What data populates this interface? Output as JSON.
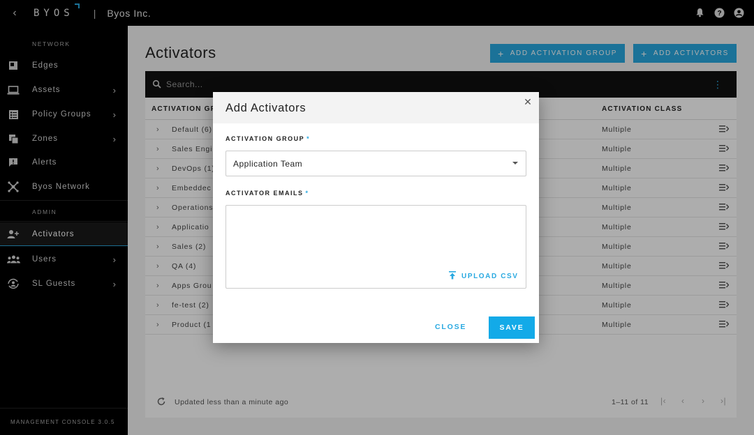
{
  "topbar": {
    "logo": "BYOS",
    "org_name": "Byos Inc."
  },
  "sidebar": {
    "network_label": "NETWORK",
    "admin_label": "ADMIN",
    "items": [
      {
        "label": "Edges"
      },
      {
        "label": "Assets"
      },
      {
        "label": "Policy Groups"
      },
      {
        "label": "Zones"
      },
      {
        "label": "Alerts"
      },
      {
        "label": "Byos Network"
      },
      {
        "label": "Activators"
      },
      {
        "label": "Users"
      },
      {
        "label": "SL Guests"
      }
    ],
    "version": "MANAGEMENT CONSOLE 3.0.5"
  },
  "main": {
    "title": "Activators",
    "add_group_label": "ADD ACTIVATION GROUP",
    "add_activators_label": "ADD ACTIVATORS",
    "search_placeholder": "Search...",
    "columns": {
      "group": "ACTIVATION GR",
      "class": "ACTIVATION CLASS"
    },
    "rows": [
      {
        "name": "Default (6)",
        "class": "Multiple"
      },
      {
        "name": "Sales Engi",
        "class": "Multiple"
      },
      {
        "name": "DevOps (1)",
        "class": "Multiple"
      },
      {
        "name": "Embeddec",
        "class": "Multiple"
      },
      {
        "name": "Operations",
        "class": "Multiple"
      },
      {
        "name": "Applicatio",
        "class": "Multiple"
      },
      {
        "name": "Sales (2)",
        "class": "Multiple"
      },
      {
        "name": "QA (4)",
        "class": "Multiple"
      },
      {
        "name": "Apps Grou",
        "class": "Multiple"
      },
      {
        "name": "fe-test (2)",
        "class": "Multiple"
      },
      {
        "name": "Product (1",
        "class": "Multiple"
      }
    ],
    "footer": {
      "updated": "Updated less than a minute ago",
      "pagination": "1–11 of 11"
    }
  },
  "dialog": {
    "title": "Add Activators",
    "group_label": "ACTIVATION GROUP",
    "required_mark": "*",
    "group_value": "Application Team",
    "emails_label": "ACTIVATOR EMAILS",
    "emails_value": "",
    "upload_label": "UPLOAD CSV",
    "close_label": "CLOSE",
    "save_label": "SAVE"
  },
  "colors": {
    "accent": "#29a9e1",
    "sidebar_bg": "#000000",
    "main_bg": "#f4f4f4"
  }
}
